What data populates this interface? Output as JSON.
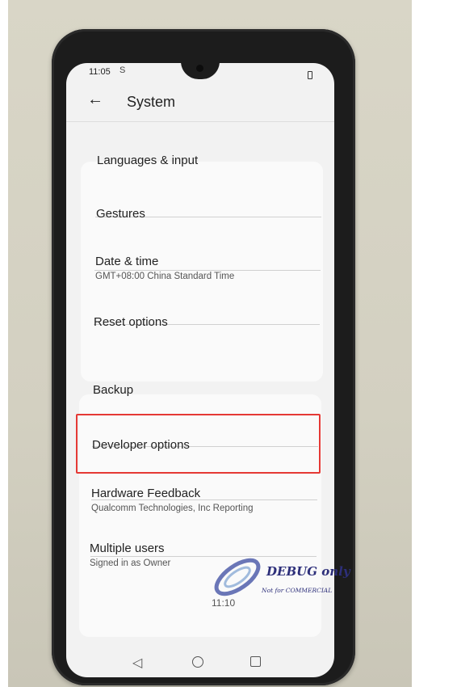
{
  "status_bar": {
    "time": "11:05",
    "notification_icon": "S"
  },
  "header": {
    "back_icon": "arrow-left",
    "title": "System"
  },
  "settings": {
    "items": [
      {
        "title": "Languages & input",
        "subtitle": ""
      },
      {
        "title": "Gestures",
        "subtitle": ""
      },
      {
        "title": "Date & time",
        "subtitle": "GMT+08:00 China Standard Time"
      },
      {
        "title": "Reset options",
        "subtitle": ""
      },
      {
        "title": "Backup",
        "subtitle": ""
      },
      {
        "title": "Developer options",
        "subtitle": ""
      },
      {
        "title": "Hardware Feedback",
        "subtitle": "Qualcomm Technologies, Inc Reporting"
      },
      {
        "title": "Multiple users",
        "subtitle": "Signed in as Owner"
      }
    ]
  },
  "clock_overlay": "11:10",
  "watermark": {
    "text": "DEBUG only",
    "subtext": "Not for COMMERCIAL"
  },
  "nav_bar": {
    "icons": [
      "back-triangle",
      "home-circle",
      "recents-square"
    ]
  },
  "highlight_color": "#e53935"
}
